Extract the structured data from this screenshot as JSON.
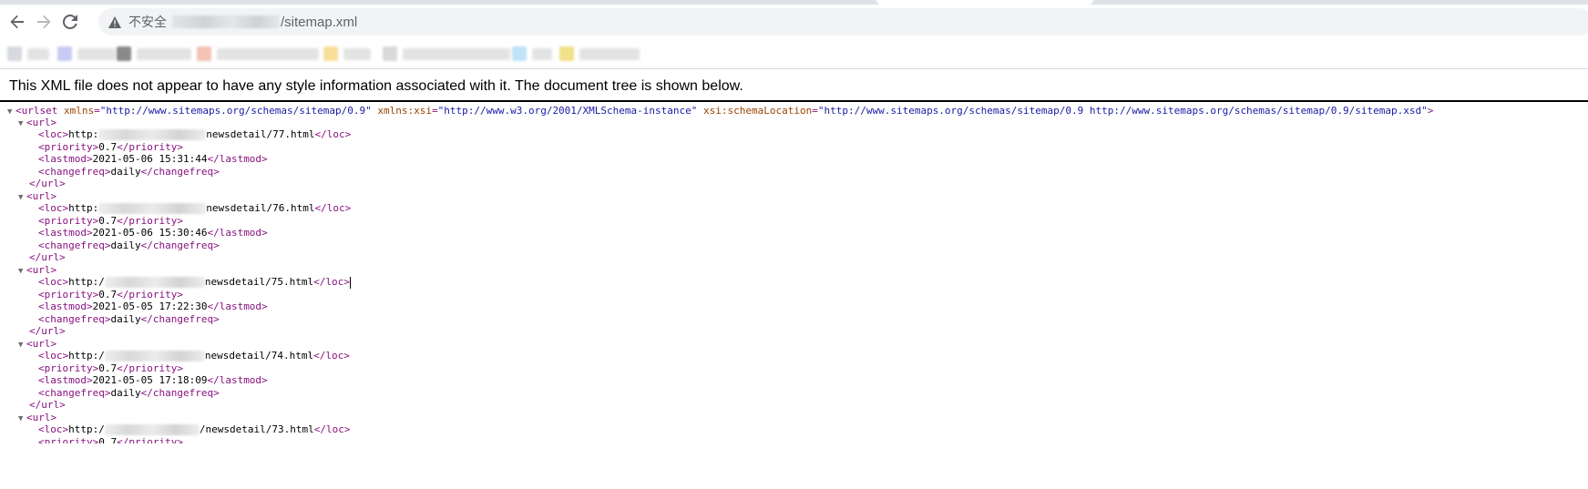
{
  "browser": {
    "address": {
      "security_label": "不安全",
      "url_path": "/sitemap.xml"
    },
    "icons": {
      "back": "arrow-left-icon",
      "forward": "arrow-right-icon",
      "reload": "reload-icon",
      "security": "warning-triangle-icon"
    }
  },
  "page": {
    "info_text": "This XML file does not appear to have any style information associated with it. The document tree is shown below.",
    "xml": {
      "root_open": "<urlset",
      "xmlns_attr": "xmlns",
      "xmlns_val": "\"http://www.sitemaps.org/schemas/sitemap/0.9\"",
      "xsi_attr": "xmlns:xsi",
      "xsi_val": "\"http://www.w3.org/2001/XMLSchema-instance\"",
      "schema_attr": "xsi:schemaLocation",
      "schema_val": "\"http://www.sitemaps.org/schemas/sitemap/0.9 http://www.sitemaps.org/schemas/sitemap/0.9/sitemap.xsd\"",
      "root_close": ">",
      "url_open": "<url>",
      "url_close": "</url>",
      "loc_open": "<loc>",
      "loc_close": "</loc>",
      "priority_open": "<priority>",
      "priority_close": "</priority>",
      "lastmod_open": "<lastmod>",
      "lastmod_close": "</lastmod>",
      "changefreq_open": "<changefreq>",
      "changefreq_close": "</changefreq>",
      "urls": [
        {
          "loc_prefix": "http:",
          "loc_suffix": "newsdetail/77.html",
          "priority": "0.7",
          "lastmod": "2021-05-06 15:31:44",
          "changefreq": "daily"
        },
        {
          "loc_prefix": "http:",
          "loc_suffix": "newsdetail/76.html",
          "priority": "0.7",
          "lastmod": "2021-05-06 15:30:46",
          "changefreq": "daily"
        },
        {
          "loc_prefix": "http:/",
          "loc_suffix": "newsdetail/75.html",
          "priority": "0.7",
          "lastmod": "2021-05-05 17:22:30",
          "changefreq": "daily"
        },
        {
          "loc_prefix": "http:/",
          "loc_suffix": "newsdetail/74.html",
          "priority": "0.7",
          "lastmod": "2021-05-05 17:18:09",
          "changefreq": "daily"
        },
        {
          "loc_prefix": "http:/",
          "loc_suffix": "/newsdetail/73.html",
          "priority": "0.7",
          "lastmod": "",
          "changefreq": ""
        }
      ]
    }
  },
  "colors": {
    "tag": "#881280",
    "attribute_name": "#994500",
    "attribute_value": "#1a1aa6",
    "omnibox_bg": "#f1f3f4"
  }
}
